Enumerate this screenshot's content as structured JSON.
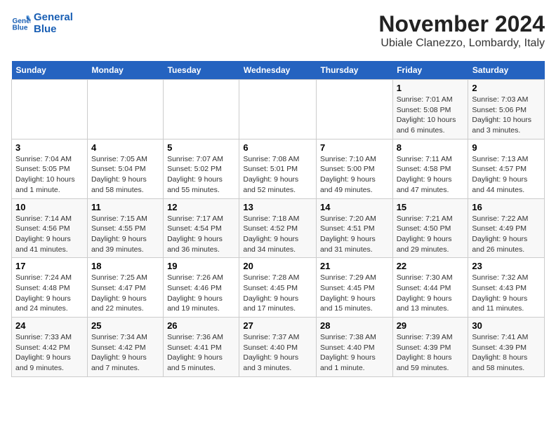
{
  "logo": {
    "line1": "General",
    "line2": "Blue"
  },
  "title": "November 2024",
  "location": "Ubiale Clanezzo, Lombardy, Italy",
  "weekdays": [
    "Sunday",
    "Monday",
    "Tuesday",
    "Wednesday",
    "Thursday",
    "Friday",
    "Saturday"
  ],
  "weeks": [
    [
      {
        "day": "",
        "info": ""
      },
      {
        "day": "",
        "info": ""
      },
      {
        "day": "",
        "info": ""
      },
      {
        "day": "",
        "info": ""
      },
      {
        "day": "",
        "info": ""
      },
      {
        "day": "1",
        "info": "Sunrise: 7:01 AM\nSunset: 5:08 PM\nDaylight: 10 hours and 6 minutes."
      },
      {
        "day": "2",
        "info": "Sunrise: 7:03 AM\nSunset: 5:06 PM\nDaylight: 10 hours and 3 minutes."
      }
    ],
    [
      {
        "day": "3",
        "info": "Sunrise: 7:04 AM\nSunset: 5:05 PM\nDaylight: 10 hours and 1 minute."
      },
      {
        "day": "4",
        "info": "Sunrise: 7:05 AM\nSunset: 5:04 PM\nDaylight: 9 hours and 58 minutes."
      },
      {
        "day": "5",
        "info": "Sunrise: 7:07 AM\nSunset: 5:02 PM\nDaylight: 9 hours and 55 minutes."
      },
      {
        "day": "6",
        "info": "Sunrise: 7:08 AM\nSunset: 5:01 PM\nDaylight: 9 hours and 52 minutes."
      },
      {
        "day": "7",
        "info": "Sunrise: 7:10 AM\nSunset: 5:00 PM\nDaylight: 9 hours and 49 minutes."
      },
      {
        "day": "8",
        "info": "Sunrise: 7:11 AM\nSunset: 4:58 PM\nDaylight: 9 hours and 47 minutes."
      },
      {
        "day": "9",
        "info": "Sunrise: 7:13 AM\nSunset: 4:57 PM\nDaylight: 9 hours and 44 minutes."
      }
    ],
    [
      {
        "day": "10",
        "info": "Sunrise: 7:14 AM\nSunset: 4:56 PM\nDaylight: 9 hours and 41 minutes."
      },
      {
        "day": "11",
        "info": "Sunrise: 7:15 AM\nSunset: 4:55 PM\nDaylight: 9 hours and 39 minutes."
      },
      {
        "day": "12",
        "info": "Sunrise: 7:17 AM\nSunset: 4:54 PM\nDaylight: 9 hours and 36 minutes."
      },
      {
        "day": "13",
        "info": "Sunrise: 7:18 AM\nSunset: 4:52 PM\nDaylight: 9 hours and 34 minutes."
      },
      {
        "day": "14",
        "info": "Sunrise: 7:20 AM\nSunset: 4:51 PM\nDaylight: 9 hours and 31 minutes."
      },
      {
        "day": "15",
        "info": "Sunrise: 7:21 AM\nSunset: 4:50 PM\nDaylight: 9 hours and 29 minutes."
      },
      {
        "day": "16",
        "info": "Sunrise: 7:22 AM\nSunset: 4:49 PM\nDaylight: 9 hours and 26 minutes."
      }
    ],
    [
      {
        "day": "17",
        "info": "Sunrise: 7:24 AM\nSunset: 4:48 PM\nDaylight: 9 hours and 24 minutes."
      },
      {
        "day": "18",
        "info": "Sunrise: 7:25 AM\nSunset: 4:47 PM\nDaylight: 9 hours and 22 minutes."
      },
      {
        "day": "19",
        "info": "Sunrise: 7:26 AM\nSunset: 4:46 PM\nDaylight: 9 hours and 19 minutes."
      },
      {
        "day": "20",
        "info": "Sunrise: 7:28 AM\nSunset: 4:45 PM\nDaylight: 9 hours and 17 minutes."
      },
      {
        "day": "21",
        "info": "Sunrise: 7:29 AM\nSunset: 4:45 PM\nDaylight: 9 hours and 15 minutes."
      },
      {
        "day": "22",
        "info": "Sunrise: 7:30 AM\nSunset: 4:44 PM\nDaylight: 9 hours and 13 minutes."
      },
      {
        "day": "23",
        "info": "Sunrise: 7:32 AM\nSunset: 4:43 PM\nDaylight: 9 hours and 11 minutes."
      }
    ],
    [
      {
        "day": "24",
        "info": "Sunrise: 7:33 AM\nSunset: 4:42 PM\nDaylight: 9 hours and 9 minutes."
      },
      {
        "day": "25",
        "info": "Sunrise: 7:34 AM\nSunset: 4:42 PM\nDaylight: 9 hours and 7 minutes."
      },
      {
        "day": "26",
        "info": "Sunrise: 7:36 AM\nSunset: 4:41 PM\nDaylight: 9 hours and 5 minutes."
      },
      {
        "day": "27",
        "info": "Sunrise: 7:37 AM\nSunset: 4:40 PM\nDaylight: 9 hours and 3 minutes."
      },
      {
        "day": "28",
        "info": "Sunrise: 7:38 AM\nSunset: 4:40 PM\nDaylight: 9 hours and 1 minute."
      },
      {
        "day": "29",
        "info": "Sunrise: 7:39 AM\nSunset: 4:39 PM\nDaylight: 8 hours and 59 minutes."
      },
      {
        "day": "30",
        "info": "Sunrise: 7:41 AM\nSunset: 4:39 PM\nDaylight: 8 hours and 58 minutes."
      }
    ]
  ]
}
